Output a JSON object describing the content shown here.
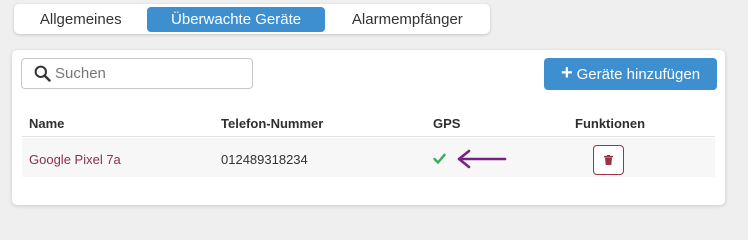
{
  "tabs": [
    {
      "label": "Allgemeines",
      "active": false
    },
    {
      "label": "Überwachte Geräte",
      "active": true
    },
    {
      "label": "Alarmempfänger",
      "active": false
    }
  ],
  "search": {
    "placeholder": "Suchen",
    "value": "",
    "icon": "search-icon"
  },
  "add_button": {
    "label": "Geräte hinzufügen",
    "icon": "plus-icon"
  },
  "table": {
    "columns": [
      "Name",
      "Telefon-Nummer",
      "GPS",
      "Funktionen"
    ],
    "rows": [
      {
        "name": "Google Pixel 7a",
        "phone": "012489318234",
        "gps": "check-icon",
        "functions": [
          "trash-icon"
        ]
      }
    ]
  },
  "annotation": {
    "icon": "arrow-left-icon"
  },
  "colors": {
    "accent": "#3d8fd0",
    "link": "#8a2f4c",
    "check": "#3bab57",
    "delete": "#9b3245",
    "arrow": "#7a2283"
  }
}
